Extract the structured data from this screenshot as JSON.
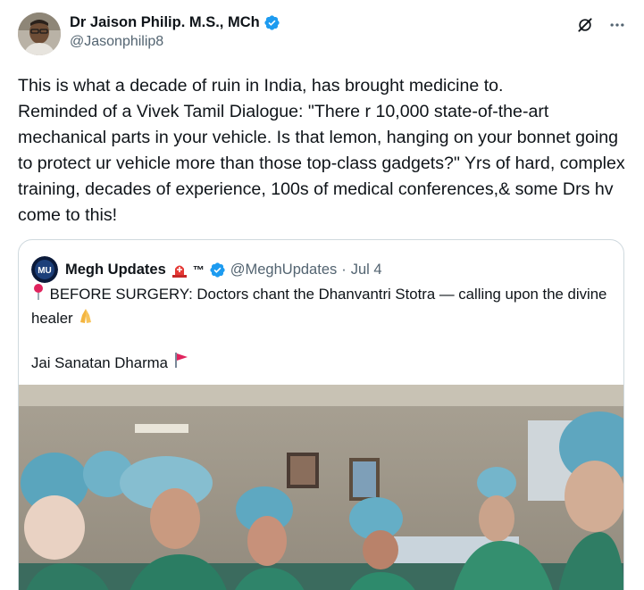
{
  "author": {
    "name": "Dr Jaison Philip. M.S., MCh",
    "handle": "@Jasonphilip8",
    "avatar_icon": "doctor-avatar-photo",
    "verified_color": "#1d9bf0"
  },
  "actions": {
    "grok_icon": "grok-icon",
    "more_icon": "more-icon"
  },
  "tweet_text": "This is what a decade of ruin in India, has brought medicine to.\nReminded of a Vivek Tamil Dialogue: \"There r 10,000 state-of-the-art mechanical parts in your vehicle. Is that lemon, hanging on your bonnet going to protect ur vehicle more than those top-class gadgets?\" Yrs of hard, complex training, decades of experience, 100s of medical conferences,& some Drs hv come to this!",
  "quote": {
    "name": "Megh Updates",
    "tm": "™",
    "handle": "@MeghUpdates",
    "dot": "·",
    "date": "Jul 4",
    "line1": "BEFORE SURGERY: Doctors chant the Dhanvantri Stotra — calling upon the divine healer",
    "line2": "Jai Sanatan Dharma",
    "media": "video-thumbnail-operating-room"
  },
  "colors": {
    "text": "#0f1419",
    "secondary": "#536471",
    "accent": "#1d9bf0",
    "border": "#cfd9de"
  }
}
